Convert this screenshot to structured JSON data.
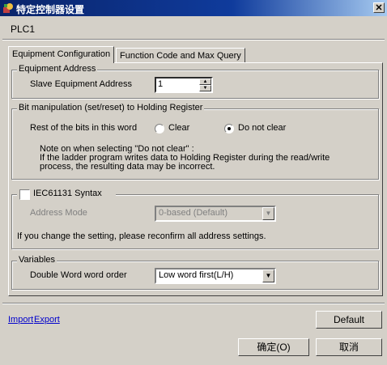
{
  "window": {
    "title": "特定控制器设置",
    "close_glyph": "✕"
  },
  "plc_name": "PLC1",
  "tabs": [
    {
      "label": "Equipment Configuration"
    },
    {
      "label": "Function Code and Max Query"
    }
  ],
  "equipment_address": {
    "legend": "Equipment Address",
    "label": "Slave Equipment Address",
    "value": "1"
  },
  "bit_manipulation": {
    "legend": "Bit manipulation (set/reset) to Holding Register",
    "label": "Rest of the bits in this word",
    "options": [
      "Clear",
      "Do not clear"
    ],
    "selected": "Do not clear",
    "note_lines": [
      "Note on when selecting \"Do not clear\" :",
      "If the ladder program writes data to Holding Register during the read/write",
      "process, the resulting data may be incorrect."
    ]
  },
  "iec": {
    "label": "IEC61131 Syntax",
    "checked": false,
    "address_mode_label": "Address Mode",
    "address_mode_value": "0-based (Default)",
    "reconfirm_note": "If you change the setting, please reconfirm all address settings."
  },
  "variables": {
    "legend": "Variables",
    "label": "Double Word word order",
    "value": "Low word first(L/H)"
  },
  "footer": {
    "import_label": "Import",
    "export_label": "Export",
    "default_label": "Default",
    "ok_label": "确定(O)",
    "cancel_label": "取消"
  },
  "colors": {
    "titlebar": "#0a246a",
    "face": "#d4d0c8",
    "link": "#0000cc"
  }
}
